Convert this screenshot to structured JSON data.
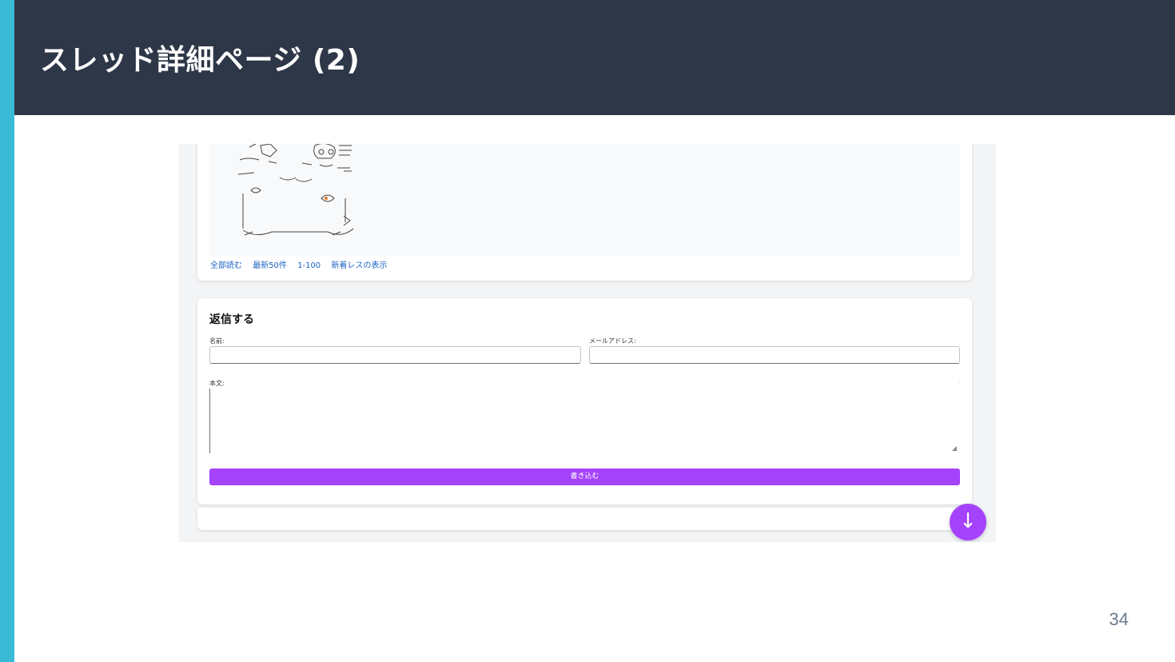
{
  "slide": {
    "title": "スレッド詳細ページ (2)",
    "page_number": "34",
    "colors": {
      "accent": "#3bbad6",
      "header_bg": "#2e3748",
      "brand_purple": "#a542fb"
    }
  },
  "thread": {
    "links": [
      "全部読む",
      "最新50件",
      "1-100",
      "新着レスの表示"
    ]
  },
  "reply_form": {
    "heading": "返信する",
    "name_label": "名前:",
    "name_value": "",
    "email_label": "メールアドレス:",
    "email_value": "",
    "body_label": "本文:",
    "body_value": "",
    "submit_label": "書き込む"
  },
  "scroll_button": {
    "glyph": "↓",
    "icon": "arrow-down-icon"
  }
}
